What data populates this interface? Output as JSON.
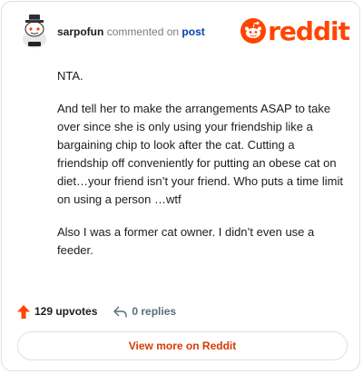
{
  "header": {
    "username": "sarpofun",
    "action": "commented on",
    "target": "post",
    "logo_text": "reddit",
    "avatar_icon": "snoo-avatar-icon",
    "brand_color": "#ff4500"
  },
  "comment": {
    "paragraphs": [
      "NTA.",
      "And tell her to make the arrangements ASAP to take over since she is only using your friendship like a bargaining chip to look after the cat. Cutting a friendship off conveniently for putting an obese cat on diet…your friend isn’t your friend. Who puts a time limit on using a person …wtf",
      "Also I was a former cat owner. I didn’t even use a feeder."
    ]
  },
  "footer": {
    "upvotes_label": "129 upvotes",
    "replies_label": "0 replies",
    "upvote_icon": "upvote-arrow-icon",
    "reply_icon": "reply-icon"
  },
  "cta": {
    "label": "View more on Reddit"
  }
}
